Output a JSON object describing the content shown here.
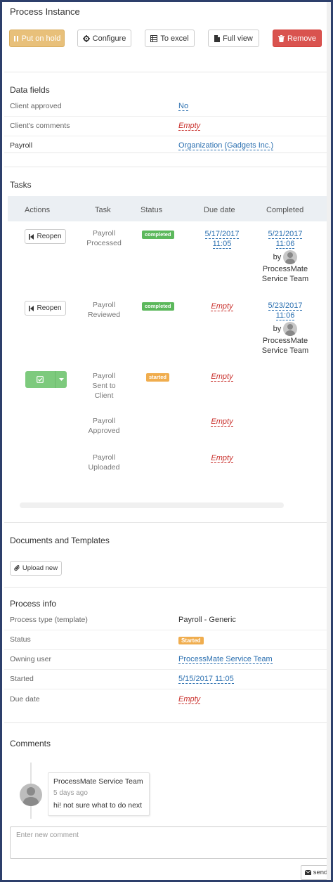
{
  "window": {
    "title": "Process Instance"
  },
  "toolbar": {
    "hold_label": "Put on hold",
    "configure_label": "Configure",
    "excel_label": "To excel",
    "full_label": "Full view",
    "remove_label": "Remove"
  },
  "data_fields": {
    "title": "Data fields",
    "rows": [
      {
        "label": "Client approved",
        "value": "No",
        "style": "link"
      },
      {
        "label": "Client's comments",
        "value": "Empty",
        "style": "empty"
      },
      {
        "label": "Payroll",
        "value": "Organization (Gadgets Inc.)",
        "style": "link"
      }
    ]
  },
  "tasks": {
    "title": "Tasks",
    "columns": [
      "Actions",
      "Task",
      "Status",
      "Due date",
      "Completed"
    ],
    "rows": [
      {
        "action": "Reopen",
        "task": [
          "Payroll",
          "Processed"
        ],
        "status": "completed",
        "due": [
          "5/17/2017",
          "11:05"
        ],
        "completed": [
          "5/21/2017",
          "11:06"
        ],
        "by": "by",
        "completed_by": [
          "ProcessMate",
          "Service Team"
        ]
      },
      {
        "action": "Reopen",
        "task": [
          "Payroll",
          "Reviewed"
        ],
        "status": "completed",
        "due": [
          "Empty"
        ],
        "completed": [
          "5/23/2017",
          "11:06"
        ],
        "by": "by",
        "completed_by": [
          "ProcessMate",
          "Service Team"
        ]
      },
      {
        "action": "",
        "task": [
          "Payroll",
          "Sent to",
          "Client"
        ],
        "status": "started",
        "due": [
          "Empty"
        ]
      },
      {
        "task": [
          "Payroll",
          "Approved"
        ],
        "due": [
          "Empty"
        ]
      },
      {
        "task": [
          "Payroll",
          "Uploaded"
        ],
        "due": [
          "Empty"
        ]
      }
    ]
  },
  "documents": {
    "title": "Documents and Templates",
    "upload_label": "Upload new"
  },
  "process_info": {
    "title": "Process info",
    "rows": [
      {
        "label": "Process type (template)",
        "value": "Payroll - Generic",
        "style": "plain"
      },
      {
        "label": "Status",
        "value": "Started",
        "style": "badge"
      },
      {
        "label": "Owning user",
        "value": "ProcessMate Service Team",
        "style": "link"
      },
      {
        "label": "Started",
        "value": "5/15/2017 11:05",
        "style": "link"
      },
      {
        "label": "Due date",
        "value": "Empty",
        "style": "empty"
      }
    ]
  },
  "comments": {
    "title": "Comments",
    "items": [
      {
        "author": "ProcessMate Service Team",
        "time": "5 days ago",
        "text": "hi! not sure what to do next"
      }
    ],
    "input_placeholder": "Enter new comment",
    "send_label": "send"
  },
  "colors": {
    "hold": "#e8c07a",
    "remove": "#d9534f",
    "completed_badge": "#5cb85c",
    "started_badge": "#f0ad4e",
    "link": "#2a6fb0",
    "empty": "#c9302c",
    "frame": "#2d3f6b"
  }
}
